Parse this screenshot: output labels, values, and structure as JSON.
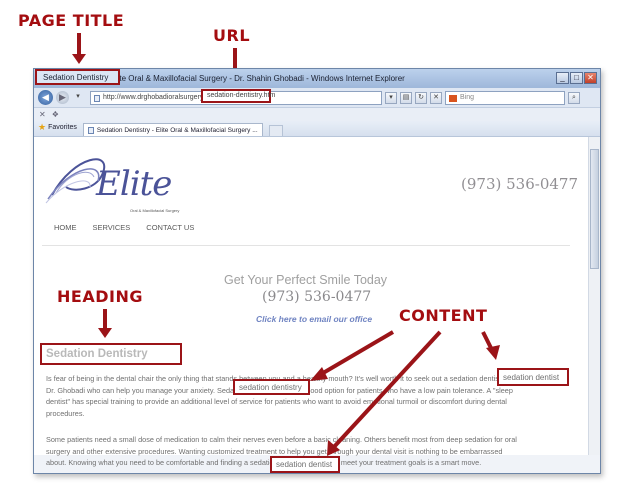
{
  "callouts": {
    "page_title": "PAGE TITLE",
    "url": "URL",
    "heading": "HEADING",
    "content": "CONTENT"
  },
  "browser": {
    "title_highlight": "Sedation Dentistry",
    "title_rest": " - Elite Oral & Maxillofacial Surgery - Dr. Shahin Ghobadi - Windows Internet Explorer",
    "address_prefix": "http://www.drghobadioralsurgery.com/",
    "address_highlight": "sedation-dentistry.htm",
    "search_placeholder": "Bing",
    "favorites_label": "Favorites",
    "tab_label": "Sedation Dentistry - Elite Oral & Maxillofacial Surgery ..."
  },
  "site": {
    "logo_text": "Elite",
    "logo_sub": "Oral & Maxillofacial Surgery",
    "phone": "(973) 536-0477",
    "menu": [
      "HOME",
      "SERVICES",
      "CONTACT US"
    ],
    "hero_title": "Get Your Perfect Smile Today",
    "hero_phone": "(973) 536-0477",
    "email_link": "Click here to email our office",
    "heading": "Sedation Dentistry",
    "para1_lines": [
      "Is fear of being in the dental chair the only thing that stands between you and a healthy mouth? It's well worth it to seek out a sedation dentist like",
      "Dr. Ghobadi who can help you manage your anxiety. Sedation dentistry is also a good option for patients who have a low pain tolerance. A \"sleep",
      "dentist\" has special training to provide an additional level of service for patients who want to avoid emotional turmoil or discomfort during dental",
      "procedures."
    ],
    "para2_lines": [
      "Some patients need a small dose of medication to calm their nerves even before a basic cleaning. Others benefit most from deep sedation for oral",
      "surgery and other extensive procedures. Wanting customized treatment to help you get through your dental visit is nothing to be embarrassed",
      "about. Knowing what you need to be comfortable and finding a sedation dentist to help you meet your treatment goals is a smart move."
    ],
    "keyword1": "sedation dentistry",
    "keyword2": "sedation dentist",
    "keyword3": "sedation dentist"
  }
}
